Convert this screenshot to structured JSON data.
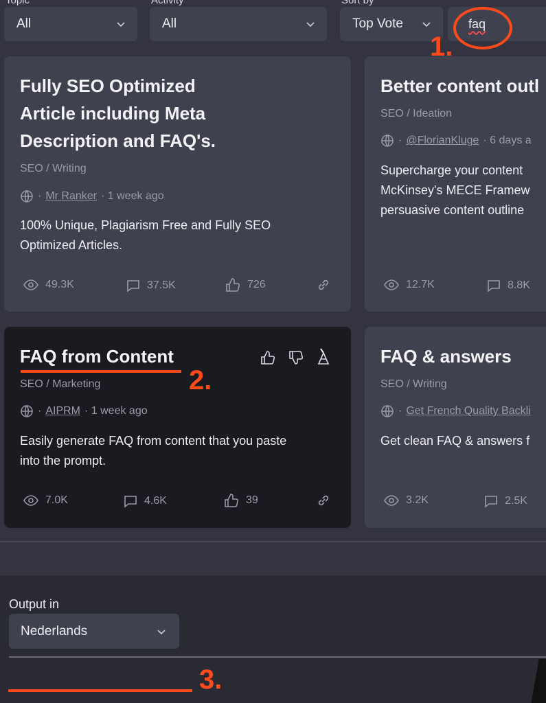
{
  "filters": {
    "topic": {
      "label": "Topic",
      "value": "All"
    },
    "activity": {
      "label": "Activity",
      "value": "All"
    },
    "sort": {
      "label": "Sort by",
      "value": "Top Vote"
    },
    "search": {
      "value": "faq"
    }
  },
  "annotations": {
    "one": "1.",
    "two": "2.",
    "three": "3."
  },
  "cards": [
    {
      "title_lines": [
        "Fully SEO Optimized",
        "Article including Meta",
        "Description and FAQ's."
      ],
      "category": "SEO / Writing",
      "author": "Mr Ranker",
      "time": "· 1 week ago",
      "description_lines": [
        "100% Unique, Plagiarism Free and Fully SEO",
        "Optimized Articles."
      ],
      "views": "49.3K",
      "comments": "37.5K",
      "likes": "726"
    },
    {
      "title_lines": [
        "Better content outl"
      ],
      "category": "SEO / Ideation",
      "author": "@FlorianKluge",
      "time": "· 6 days a",
      "description_lines": [
        "Supercharge your content",
        "McKinsey's MECE Framew",
        "persuasive content outline"
      ],
      "views": "12.7K",
      "comments": "8.8K",
      "likes": ""
    },
    {
      "title_lines": [
        "FAQ from Content"
      ],
      "category": "SEO / Marketing",
      "author": "AIPRM",
      "time": "· 1 week ago",
      "description_lines": [
        "Easily generate FAQ from content that you paste",
        "into the prompt."
      ],
      "views": "7.0K",
      "comments": "4.6K",
      "likes": "39"
    },
    {
      "title_lines": [
        "FAQ & answers"
      ],
      "category": "SEO / Writing",
      "author": "Get French Quality Backli",
      "time": "",
      "description_lines": [
        "Get clean FAQ & answers f"
      ],
      "views": "3.2K",
      "comments": "2.5K",
      "likes": ""
    }
  ],
  "output": {
    "label": "Output in",
    "value": "Nederlands"
  },
  "colors": {
    "accent_annotation": "#ff4a1c",
    "card_bg": "#40414f",
    "card_active_bg": "#1a1b20"
  }
}
